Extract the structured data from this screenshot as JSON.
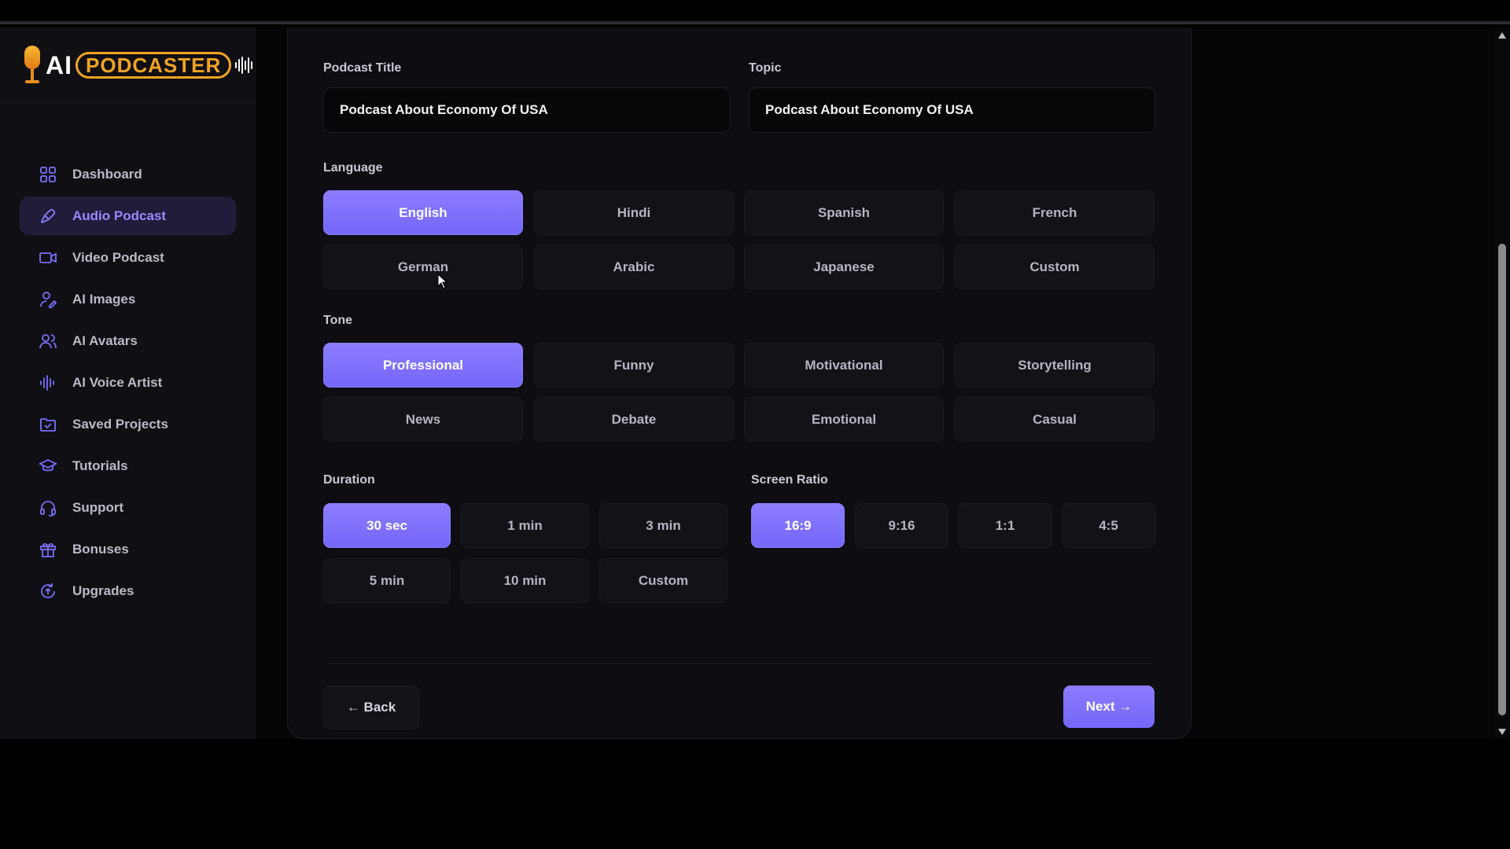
{
  "logo": {
    "prefix": "AI",
    "name": "PODCASTER"
  },
  "sidebar": {
    "items": [
      {
        "label": "Dashboard",
        "icon": "dashboard-icon",
        "active": false
      },
      {
        "label": "Audio Podcast",
        "icon": "microphone-icon",
        "active": true
      },
      {
        "label": "Video Podcast",
        "icon": "video-camera-icon",
        "active": false
      },
      {
        "label": "AI Images",
        "icon": "image-person-icon",
        "active": false
      },
      {
        "label": "AI Avatars",
        "icon": "users-icon",
        "active": false
      },
      {
        "label": "AI Voice Artist",
        "icon": "waveform-icon",
        "active": false
      },
      {
        "label": "Saved Projects",
        "icon": "folder-check-icon",
        "active": false
      },
      {
        "label": "Tutorials",
        "icon": "graduation-cap-icon",
        "active": false
      },
      {
        "label": "Support",
        "icon": "headset-icon",
        "active": false
      },
      {
        "label": "Bonuses",
        "icon": "gift-icon",
        "active": false
      },
      {
        "label": "Upgrades",
        "icon": "upgrade-icon",
        "active": false
      }
    ]
  },
  "form": {
    "title_label": "Podcast Title",
    "title_value": "Podcast About Economy Of USA",
    "topic_label": "Topic",
    "topic_value": "Podcast About Economy Of USA",
    "language_label": "Language",
    "languages": [
      "English",
      "Hindi",
      "Spanish",
      "French",
      "German",
      "Arabic",
      "Japanese",
      "Custom"
    ],
    "language_selected": "English",
    "tone_label": "Tone",
    "tones": [
      "Professional",
      "Funny",
      "Motivational",
      "Storytelling",
      "News",
      "Debate",
      "Emotional",
      "Casual"
    ],
    "tone_selected": "Professional",
    "duration_label": "Duration",
    "durations": [
      "30 sec",
      "1 min",
      "3 min",
      "5 min",
      "10 min",
      "Custom"
    ],
    "duration_selected": "30 sec",
    "ratio_label": "Screen Ratio",
    "ratios": [
      "16:9",
      "9:16",
      "1:1",
      "4:5"
    ],
    "ratio_selected": "16:9",
    "back_label": "← Back",
    "next_label": "Next →"
  },
  "colors": {
    "accent": "#7b6dfb",
    "sidebar_active_bg": "#211c3a",
    "logo_orange": "#f2a323"
  }
}
